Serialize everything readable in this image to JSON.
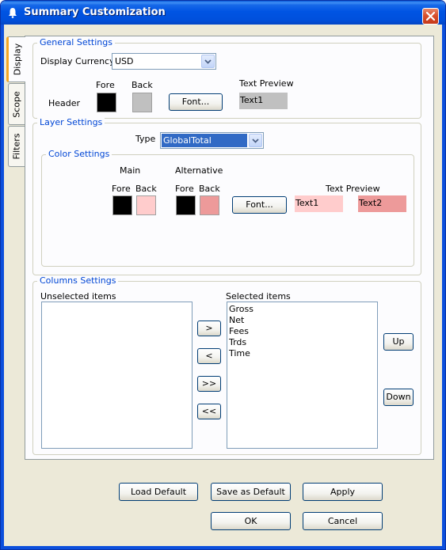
{
  "window": {
    "title": "Summary Customization"
  },
  "tabs": [
    "Display",
    "Scope",
    "Filters"
  ],
  "general": {
    "title": "General Settings",
    "currency_label": "Display Currency:",
    "currency_value": "USD",
    "fore_label": "Fore",
    "back_label": "Back",
    "text_preview_label": "Text Preview",
    "header_label": "Header",
    "font_button": "Font...",
    "preview_text": "Text1",
    "colors": {
      "fore": "#000000",
      "back": "#c0c0c0"
    }
  },
  "layer": {
    "title": "Layer Settings",
    "type_label": "Type",
    "type_value": "GlobalTotal",
    "color_settings": {
      "title": "Color Settings",
      "main_label": "Main",
      "alternative_label": "Alternative",
      "main_fore": "Fore",
      "main_back": "Back",
      "alt_fore": "Fore",
      "alt_back": "Back",
      "font_button": "Font...",
      "text_preview_label": "Text Preview",
      "preview_text1": "Text1",
      "preview_text2": "Text2",
      "colors": {
        "main_fore": "#000000",
        "main_back": "#ffcccc",
        "alt_fore": "#000000",
        "alt_back": "#ed9a9a"
      }
    }
  },
  "columns": {
    "title": "Columns Settings",
    "unselected_label": "Unselected items",
    "selected_label": "Selected items",
    "selected_items": [
      "Gross",
      "Net",
      "Fees",
      "Trds",
      "Time"
    ],
    "buttons": {
      "add": ">",
      "remove": "<",
      "add_all": ">>",
      "remove_all": "<<",
      "up": "Up",
      "down": "Down"
    }
  },
  "footer": {
    "load_default": "Load Default",
    "save_default": "Save as Default",
    "apply": "Apply",
    "ok": "OK",
    "cancel": "Cancel"
  }
}
